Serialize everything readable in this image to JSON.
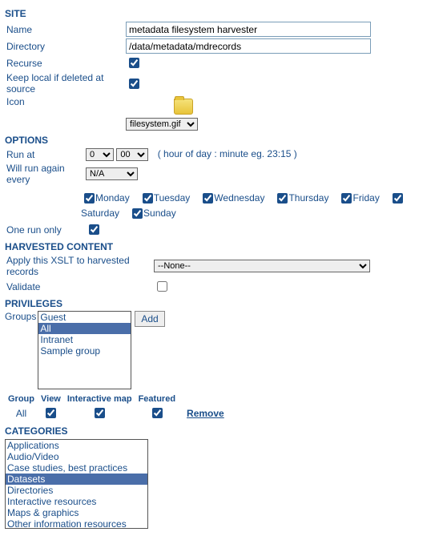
{
  "site": {
    "header": "SITE",
    "name_label": "Name",
    "name_value": "metadata filesystem harvester",
    "directory_label": "Directory",
    "directory_value": "/data/metadata/mdrecords",
    "recurse_label": "Recurse",
    "recurse_checked": true,
    "keep_local_label": "Keep local if deleted at source",
    "keep_local_checked": true,
    "icon_label": "Icon",
    "icon_select": "filesystem.gif"
  },
  "options": {
    "header": "OPTIONS",
    "run_at_label": "Run at",
    "run_at_hour": "0",
    "run_at_minute": "00",
    "run_at_hint": "( hour of day : minute eg. 23:15 )",
    "will_run_label": "Will run again every",
    "will_run_value": "N/A",
    "days": [
      "Monday",
      "Tuesday",
      "Wednesday",
      "Thursday",
      "Friday",
      "Saturday",
      "Sunday"
    ],
    "one_run_label": "One run only",
    "one_run_checked": true
  },
  "harvested": {
    "header": "HARVESTED CONTENT",
    "xslt_label": "Apply this XSLT to harvested records",
    "xslt_value": "--None--",
    "validate_label": "Validate",
    "validate_checked": false
  },
  "privileges": {
    "header": "PRIVILEGES",
    "groups_label": "Groups",
    "groups": [
      "Guest",
      "All",
      "Intranet",
      "Sample group"
    ],
    "groups_selected": "All",
    "add_label": "Add",
    "col_group": "Group",
    "col_view": "View",
    "col_interactive": "Interactive map",
    "col_featured": "Featured",
    "row_group": "All",
    "view_checked": true,
    "interactive_checked": true,
    "featured_checked": true,
    "remove_label": "Remove"
  },
  "categories": {
    "header": "CATEGORIES",
    "items": [
      "Applications",
      "Audio/Video",
      "Case studies, best practices",
      "Datasets",
      "Directories",
      "Interactive resources",
      "Maps & graphics",
      "Other information resources"
    ],
    "selected": "Datasets"
  }
}
